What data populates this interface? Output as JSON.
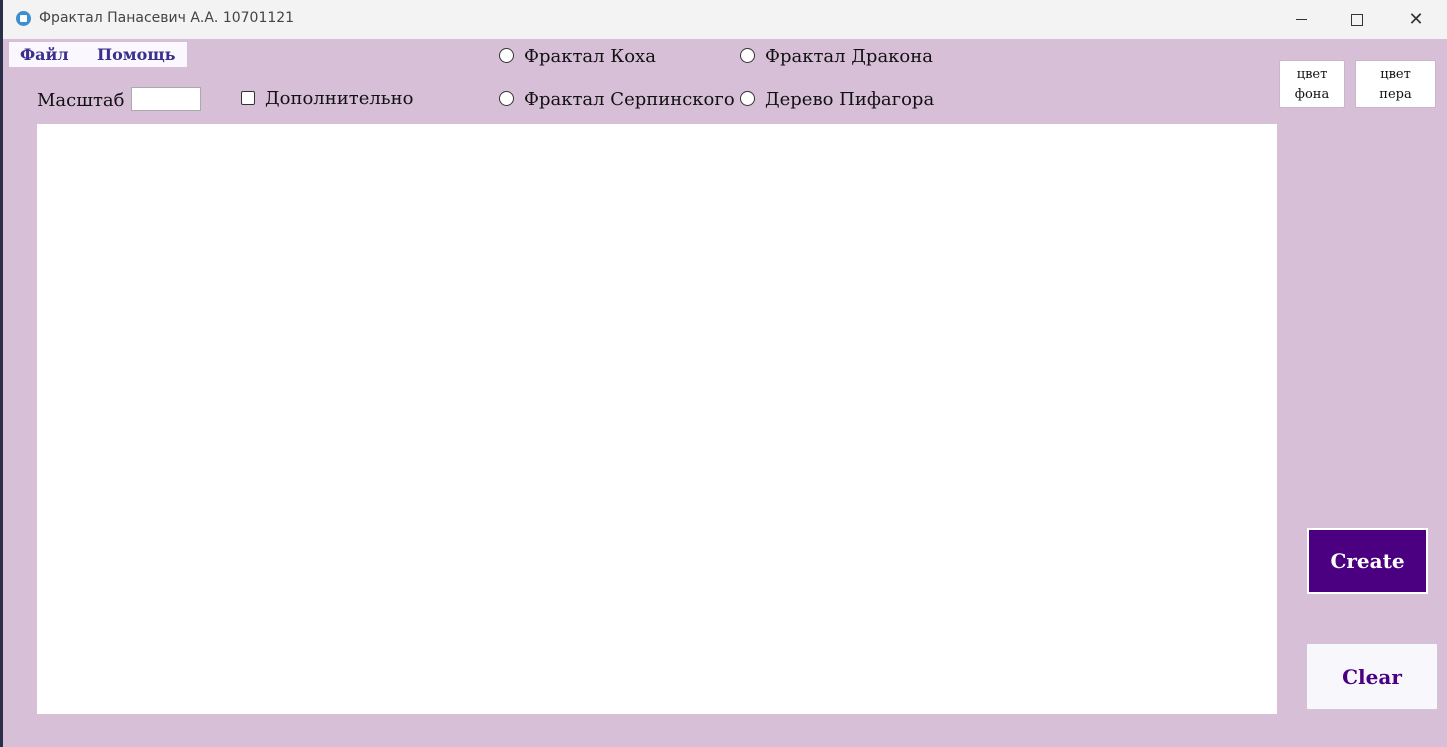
{
  "window": {
    "title": "Фрактал Панасевич А.А. 10701121"
  },
  "menu": {
    "file": "Файл",
    "help": "Помощь"
  },
  "controls": {
    "scale_label": "Масштаб",
    "scale_value": "",
    "extra_label": "Дополнительно",
    "extra_checked": false
  },
  "fractals": {
    "koch": "Фрактал Коха",
    "dragon": "Фрактал Дракона",
    "sierpinski": "Фрактал Серпинского",
    "pythagoras": "Дерево Пифагора"
  },
  "color_buttons": {
    "bg_line1": "цвет",
    "bg_line2": "фона",
    "pen_line1": "цвет",
    "pen_line2": "пера"
  },
  "actions": {
    "create": "Create",
    "clear": "Clear"
  },
  "colors": {
    "background": "#d8bfd8",
    "create_button": "#4b0082",
    "canvas": "#ffffff"
  }
}
